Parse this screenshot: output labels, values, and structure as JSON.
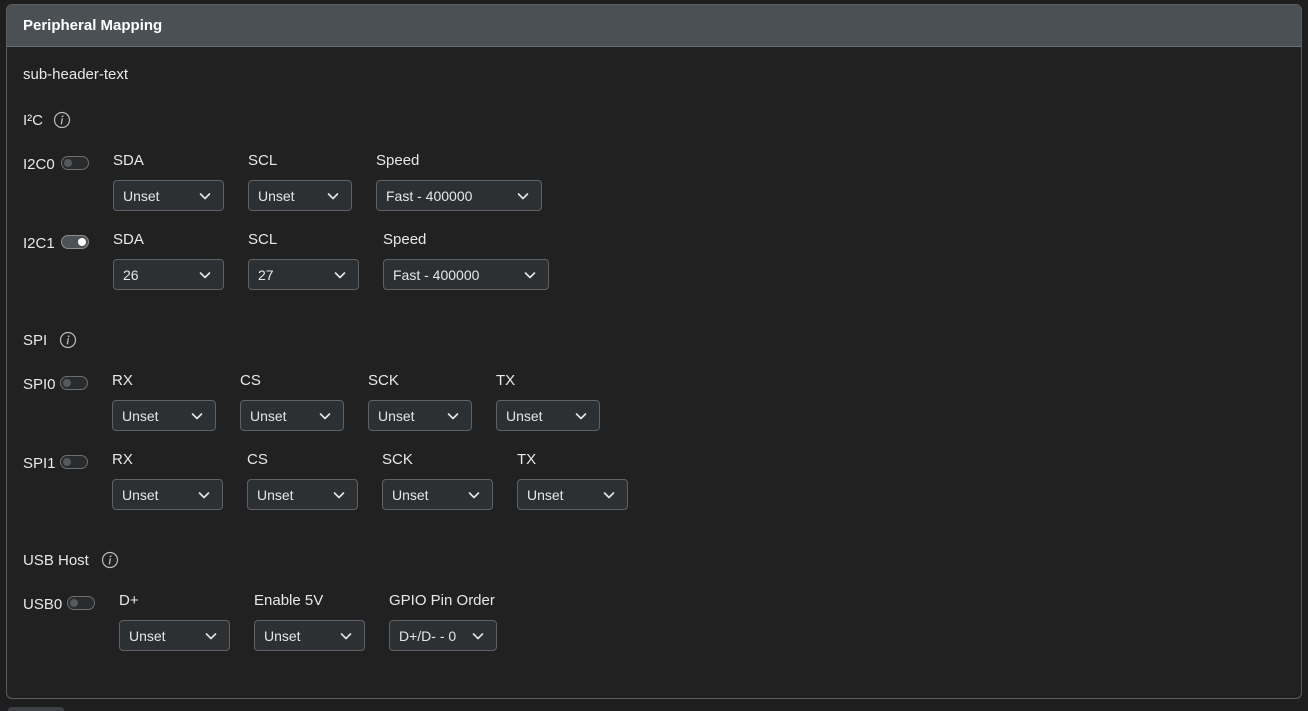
{
  "header": {
    "title": "Peripheral Mapping"
  },
  "sub_header": "sub-header-text",
  "i2c": {
    "title": "I²C",
    "rows": [
      {
        "label": "I2C0",
        "enabled": false,
        "fields": {
          "sda": {
            "label": "SDA",
            "value": "Unset"
          },
          "scl": {
            "label": "SCL",
            "value": "Unset"
          },
          "speed": {
            "label": "Speed",
            "value": "Fast - 400000"
          }
        }
      },
      {
        "label": "I2C1",
        "enabled": true,
        "fields": {
          "sda": {
            "label": "SDA",
            "value": "26"
          },
          "scl": {
            "label": "SCL",
            "value": "27"
          },
          "speed": {
            "label": "Speed",
            "value": "Fast - 400000"
          }
        }
      }
    ]
  },
  "spi": {
    "title": "SPI",
    "rows": [
      {
        "label": "SPI0",
        "enabled": false,
        "fields": {
          "rx": {
            "label": "RX",
            "value": "Unset"
          },
          "cs": {
            "label": "CS",
            "value": "Unset"
          },
          "sck": {
            "label": "SCK",
            "value": "Unset"
          },
          "tx": {
            "label": "TX",
            "value": "Unset"
          }
        }
      },
      {
        "label": "SPI1",
        "enabled": false,
        "fields": {
          "rx": {
            "label": "RX",
            "value": "Unset"
          },
          "cs": {
            "label": "CS",
            "value": "Unset"
          },
          "sck": {
            "label": "SCK",
            "value": "Unset"
          },
          "tx": {
            "label": "TX",
            "value": "Unset"
          }
        }
      }
    ]
  },
  "usb": {
    "title": "USB Host",
    "rows": [
      {
        "label": "USB0",
        "enabled": false,
        "fields": {
          "dplus": {
            "label": "D+",
            "value": "Unset"
          },
          "enable5v": {
            "label": "Enable 5V",
            "value": "Unset"
          },
          "order": {
            "label": "GPIO Pin Order",
            "value": "D+/D- - 0"
          }
        }
      }
    ]
  },
  "icons": {
    "info": "info-icon",
    "dropdown": "chevron-down-icon"
  },
  "colors": {
    "header_bg": "#4b5054",
    "panel_bg": "#212122",
    "select_bg": "#2d3033",
    "border": "#5e6266"
  }
}
